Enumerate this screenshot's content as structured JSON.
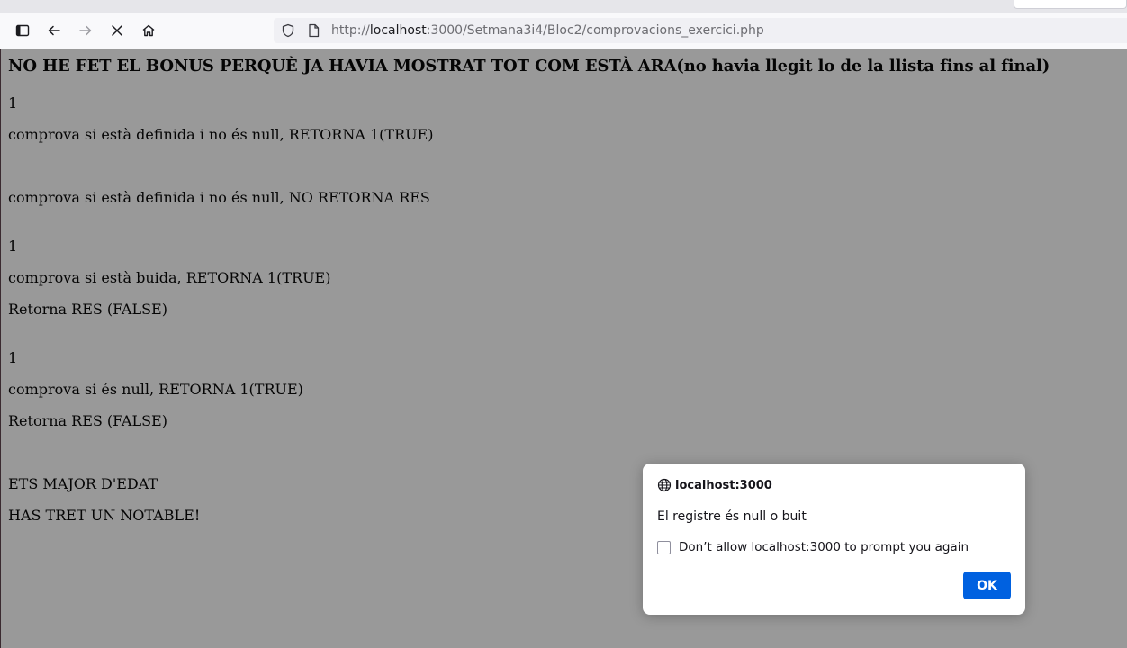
{
  "browser": {
    "url_prefix": "http://",
    "url_host": "localhost",
    "url_rest": ":3000/Setmana3i4/Bloc2/comprovacions_exercici.php",
    "icons": {
      "sidebar": "sidebar-icon",
      "back": "back-arrow-icon",
      "forward": "forward-arrow-icon",
      "stop": "stop-x-icon",
      "home": "home-icon",
      "tracking": "shield-icon",
      "page_info": "page-icon"
    }
  },
  "page": {
    "heading": "NO HE FET EL BONUS PERQUÈ JA HAVIA MOSTRAT TOT COM ESTÀ ARA(no havia llegit lo de la llista fins al final)",
    "lines": [
      "1",
      "comprova si està definida i no és null, RETORNA 1(TRUE)",
      "comprova si està definida i no és null, NO RETORNA RES",
      "1",
      "comprova si està buida, RETORNA 1(TRUE)",
      "Retorna RES (FALSE)",
      "1",
      "comprova si és null, RETORNA 1(TRUE)",
      "Retorna RES (FALSE)",
      "ETS MAJOR D'EDAT",
      "HAS TRET UN NOTABLE!"
    ]
  },
  "dialog": {
    "origin": "localhost:3000",
    "message": "El registre és null o buit",
    "checkbox_label": "Don’t allow localhost:3000 to prompt you again",
    "checkbox_checked": false,
    "ok_label": "OK",
    "ok_color": "#0061e0"
  }
}
